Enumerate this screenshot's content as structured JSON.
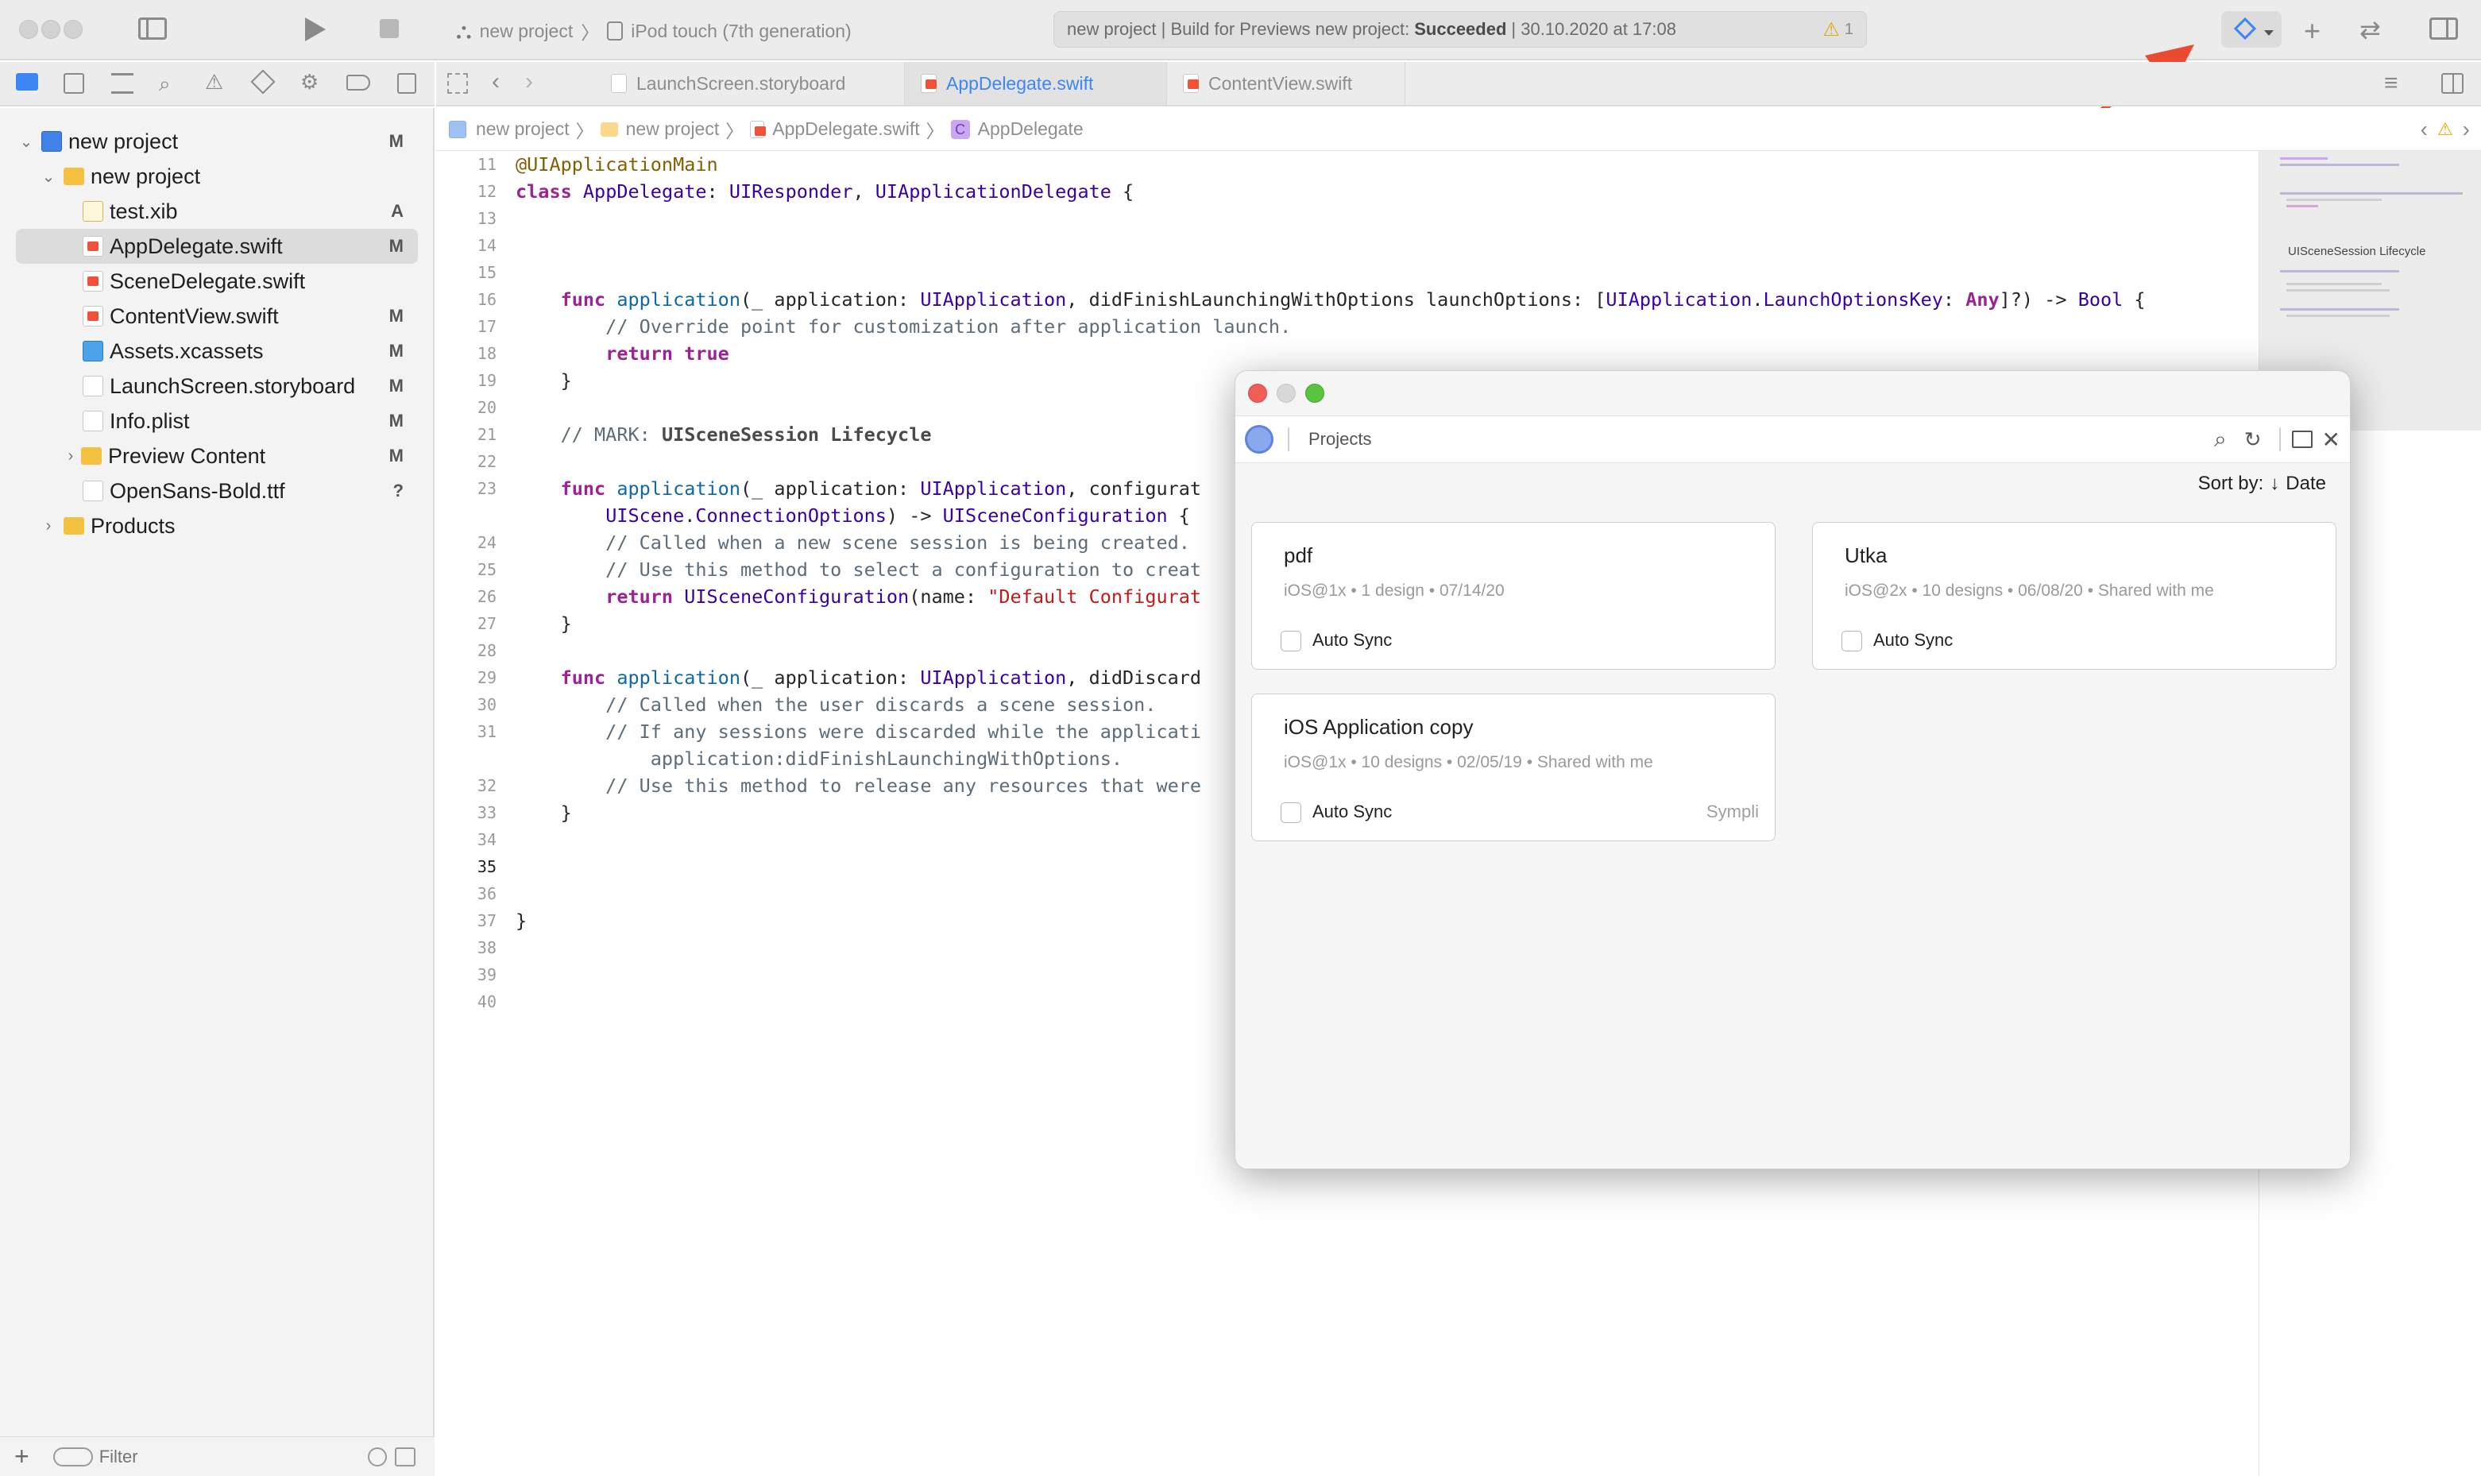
{
  "toolbar": {
    "scheme": "new project",
    "device": "iPod touch (7th generation)",
    "status_prefix": "new project | Build for Previews new project:",
    "status_result": "Succeeded",
    "status_time": "| 30.10.2020 at 17:08",
    "warning_count": "1"
  },
  "tabs": [
    {
      "label": "LaunchScreen.storyboard"
    },
    {
      "label": "AppDelegate.swift"
    },
    {
      "label": "ContentView.swift"
    }
  ],
  "jumpbar": [
    "new project",
    "new project",
    "AppDelegate.swift",
    "AppDelegate"
  ],
  "sidebar": {
    "items": [
      {
        "label": "new project",
        "badge": "M"
      },
      {
        "label": "new project",
        "badge": ""
      },
      {
        "label": "test.xib",
        "badge": "A"
      },
      {
        "label": "AppDelegate.swift",
        "badge": "M"
      },
      {
        "label": "SceneDelegate.swift",
        "badge": ""
      },
      {
        "label": "ContentView.swift",
        "badge": "M"
      },
      {
        "label": "Assets.xcassets",
        "badge": "M"
      },
      {
        "label": "LaunchScreen.storyboard",
        "badge": "M"
      },
      {
        "label": "Info.plist",
        "badge": "M"
      },
      {
        "label": "Preview Content",
        "badge": "M"
      },
      {
        "label": "OpenSans-Bold.ttf",
        "badge": "?"
      },
      {
        "label": "Products",
        "badge": ""
      }
    ],
    "filter_placeholder": "Filter"
  },
  "editor": {
    "line_numbers": [
      "11",
      "12",
      "13",
      "14",
      "15",
      "16",
      "17",
      "18",
      "19",
      "20",
      "21",
      "22",
      "23",
      "",
      "24",
      "25",
      "26",
      "27",
      "28",
      "29",
      "30",
      "31",
      "",
      "32",
      "33",
      "34",
      "35",
      "36",
      "37",
      "38",
      "39",
      "40"
    ]
  },
  "minimap": {
    "label": "UISceneSession Lifecycle"
  },
  "popup": {
    "search_title": "Projects",
    "sort_label": "Sort by:",
    "sort_value": "Date",
    "cards": [
      {
        "title": "pdf",
        "meta": "iOS@1x • 1 design • 07/14/20",
        "sync": "Auto Sync",
        "brand": ""
      },
      {
        "title": "Utka",
        "meta": "iOS@2x • 10 designs • 06/08/20 • Shared with me",
        "sync": "Auto Sync",
        "brand": ""
      },
      {
        "title": "iOS Application copy",
        "meta": "iOS@1x • 10 designs • 02/05/19 • Shared with me",
        "sync": "Auto Sync",
        "brand": "Sympli"
      }
    ]
  }
}
